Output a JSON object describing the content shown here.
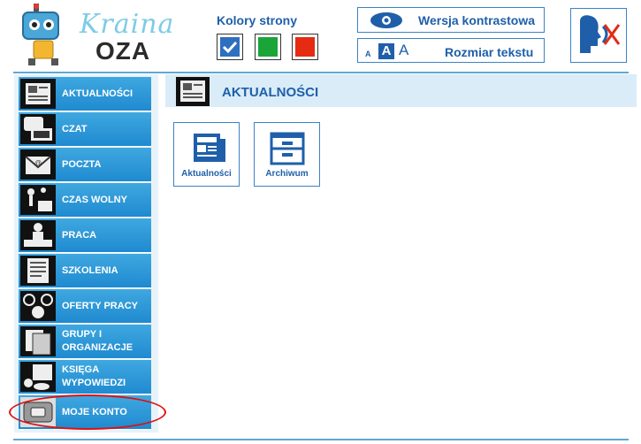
{
  "logo": {
    "line1": "Kraina",
    "line2": "OZA",
    "badge": "OZA"
  },
  "colors": {
    "title": "Kolory strony",
    "options": [
      {
        "name": "blue",
        "color": "#2f6fc0",
        "selected": true
      },
      {
        "name": "green",
        "color": "#19a538",
        "selected": false
      },
      {
        "name": "red",
        "color": "#e52b12",
        "selected": false
      }
    ]
  },
  "contrast": {
    "label": "Wersja kontrastowa",
    "icon": "eye-icon"
  },
  "text_size": {
    "label": "Rozmiar tekstu",
    "small": "A",
    "medium": "A",
    "large": "A"
  },
  "speech": {
    "icon": "speech-off-icon"
  },
  "sidebar": {
    "items": [
      {
        "label": "AKTUALNOŚCI",
        "icon": "newspaper-icon"
      },
      {
        "label": "CZAT",
        "icon": "chat-computer-icon"
      },
      {
        "label": "POCZTA",
        "icon": "mail-icon"
      },
      {
        "label": "CZAS WOLNY",
        "icon": "leisure-icon"
      },
      {
        "label": "PRACA",
        "icon": "work-icon"
      },
      {
        "label": "SZKOLENIA",
        "icon": "training-icon"
      },
      {
        "label": "OFERTY PRACY",
        "icon": "job-offers-icon"
      },
      {
        "label": "GRUPY I ORGANIZACJE",
        "icon": "groups-icon"
      },
      {
        "label": "KSIĘGA WYPOWIEDZI",
        "icon": "guestbook-icon"
      },
      {
        "label": "MOJE KONTO",
        "icon": "account-icon"
      }
    ]
  },
  "main": {
    "title": "AKTUALNOŚCI",
    "tiles": [
      {
        "label": "Aktualności",
        "icon": "news-icon"
      },
      {
        "label": "Archiwum",
        "icon": "archive-icon"
      }
    ]
  }
}
